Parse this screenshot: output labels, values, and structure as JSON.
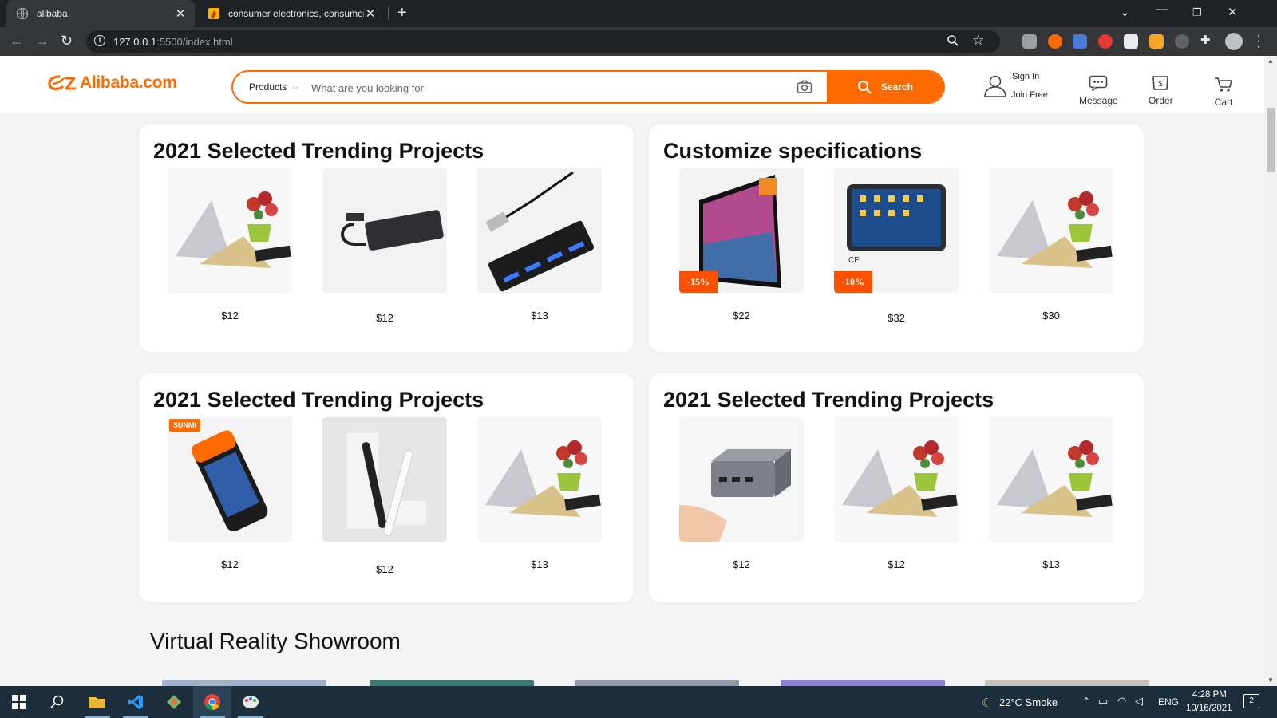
{
  "browser": {
    "tabs": [
      {
        "title": "alibaba",
        "active": true
      },
      {
        "title": "consumer electronics, consumer",
        "active": false
      }
    ],
    "url_host": "127.0.0.1",
    "url_rest": ":5500/index.html"
  },
  "header": {
    "logo_text": "Alibaba.com",
    "search": {
      "category": "Products",
      "placeholder": "What are you looking for",
      "button_label": "Search"
    },
    "account": {
      "signin": "Sign In",
      "join": "Join Free"
    },
    "nav": {
      "message": "Message",
      "order": "Order",
      "cart": "Cart"
    }
  },
  "cards": [
    {
      "title": "2021 Selected Trending Projects",
      "products": [
        {
          "price": "$12",
          "image": "gift-box"
        },
        {
          "price": "$12",
          "image": "ssd-enclosure"
        },
        {
          "price": "$13",
          "image": "usb-hub"
        }
      ]
    },
    {
      "title": "Customize specifications",
      "products": [
        {
          "price": "$22",
          "image": "4k-monitor",
          "badge": "-15%"
        },
        {
          "price": "$32",
          "image": "tablet",
          "badge": "-10%"
        },
        {
          "price": "$30",
          "image": "gift-box"
        }
      ]
    },
    {
      "title": "2021 Selected Trending Projects",
      "products": [
        {
          "price": "$12",
          "image": "pos-terminal",
          "brand": "SUNMI"
        },
        {
          "price": "$12",
          "image": "electric-toothbrush"
        },
        {
          "price": "$13",
          "image": "gift-box"
        }
      ]
    },
    {
      "title": "2021 Selected Trending Projects",
      "products": [
        {
          "price": "$12",
          "image": "mini-pc"
        },
        {
          "price": "$12",
          "image": "gift-box"
        },
        {
          "price": "$13",
          "image": "gift-box"
        }
      ]
    }
  ],
  "section": {
    "title": "Virtual Reality Showroom"
  },
  "taskbar": {
    "weather": "22°C  Smoke",
    "language": "ENG",
    "time": "4:28 PM",
    "date": "10/16/2021",
    "notifications": "2"
  },
  "colors": {
    "accent": "#ff6a00",
    "badge": "#ff5000",
    "chrome_dark": "#202124"
  }
}
